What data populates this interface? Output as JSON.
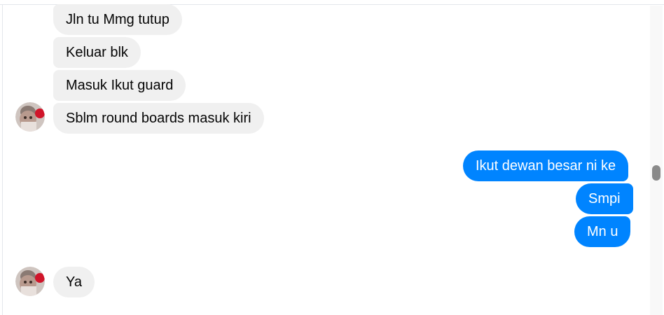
{
  "conversation": {
    "messages": [
      {
        "sender": "contact",
        "text": "Jln tu Mmg tutup"
      },
      {
        "sender": "contact",
        "text": "Keluar blk"
      },
      {
        "sender": "contact",
        "text": "Masuk Ikut guard"
      },
      {
        "sender": "contact",
        "text": "Sblm round boards masuk kiri"
      },
      {
        "sender": "me",
        "text": "Ikut dewan besar ni ke"
      },
      {
        "sender": "me",
        "text": "Smpi"
      },
      {
        "sender": "me",
        "text": "Mn u"
      },
      {
        "sender": "contact",
        "text": "Ya"
      }
    ]
  },
  "colors": {
    "incoming_bubble": "#f0f0f0",
    "outgoing_bubble": "#0084ff",
    "incoming_text": "#050505",
    "outgoing_text": "#ffffff"
  },
  "icons": {
    "contact_avatar": "contact-avatar-photo"
  }
}
